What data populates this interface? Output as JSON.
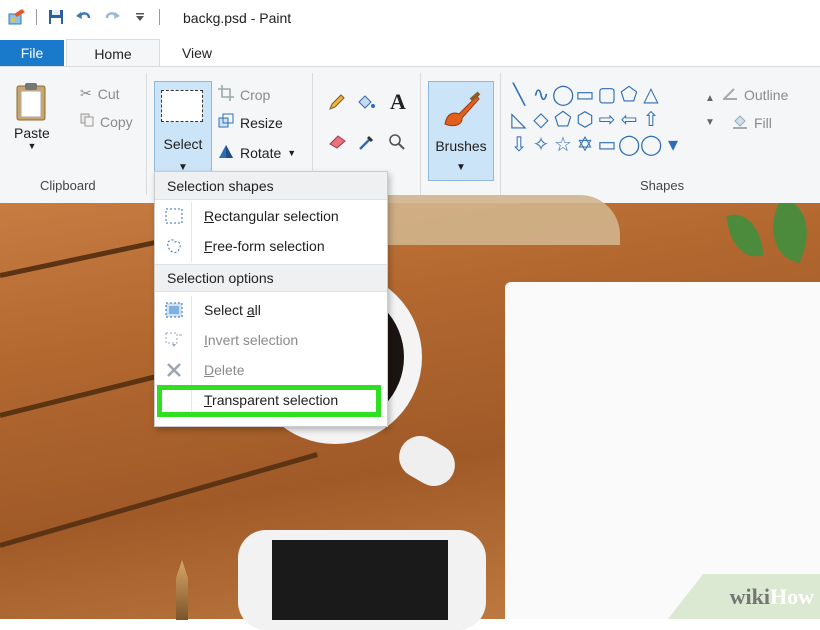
{
  "window": {
    "title": "backg.psd - Paint"
  },
  "quick_access": {
    "icons": [
      "paint-app-icon",
      "save-icon",
      "undo-icon",
      "redo-icon",
      "customize-qat-icon"
    ]
  },
  "tabs": {
    "file": "File",
    "home": "Home",
    "view": "View"
  },
  "ribbon": {
    "clipboard": {
      "paste": "Paste",
      "cut": "Cut",
      "copy": "Copy",
      "label": "Clipboard"
    },
    "image": {
      "select": "Select",
      "crop": "Crop",
      "resize": "Resize",
      "rotate": "Rotate"
    },
    "tools": {
      "icons": [
        "pencil-icon",
        "fill-icon",
        "text-icon",
        "eraser-icon",
        "color-picker-icon",
        "magnifier-icon"
      ],
      "text_glyph": "A"
    },
    "brushes": "Brushes",
    "shapes": {
      "outline": "Outline",
      "fill": "Fill",
      "label": "Shapes",
      "glyphs": [
        "╲",
        "∿",
        "◯",
        "▭",
        "▢",
        "⬠",
        "△",
        "",
        "◺",
        "◇",
        "⬠",
        "⬡",
        "⇨",
        "⇦",
        "⇧",
        "",
        "⇩",
        "✧",
        "☆",
        "✡",
        "▭",
        "◯",
        "◯",
        "▾"
      ]
    },
    "accent_color": "#1979ca"
  },
  "selection_menu": {
    "shapes_header": "Selection shapes",
    "rectangular": {
      "prefix": "R",
      "rest": "ectangular selection"
    },
    "freeform": {
      "prefix": "F",
      "rest": "ree-form selection"
    },
    "options_header": "Selection options",
    "select_all": {
      "before": "Select ",
      "key": "a",
      "after": "ll"
    },
    "invert": {
      "prefix": "I",
      "rest": "nvert selection"
    },
    "delete": {
      "prefix": "D",
      "rest": "elete"
    },
    "transparent": {
      "prefix": "T",
      "rest": "ransparent selection"
    },
    "highlight_color": "#2ee01f"
  },
  "watermark": {
    "wiki": "wiki",
    "how": "How"
  }
}
